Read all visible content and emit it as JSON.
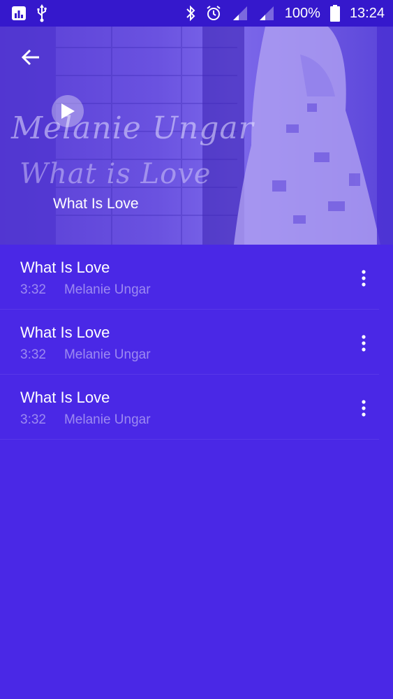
{
  "status_bar": {
    "battery": "100%",
    "time": "13:24",
    "icons": [
      "stats-icon",
      "usb-icon",
      "bluetooth-icon",
      "alarm-icon",
      "signal-icon",
      "signal-icon",
      "battery-icon"
    ]
  },
  "header": {
    "title": "What Is Love",
    "art_artist_text": "Melanie Ungar",
    "art_album_text": "What is Love",
    "back_icon": "arrow-left-icon",
    "play_icon": "play-icon"
  },
  "songs": [
    {
      "title": "What Is Love",
      "duration": "3:32",
      "artist": "Melanie Ungar"
    },
    {
      "title": "What Is Love",
      "duration": "3:32",
      "artist": "Melanie Ungar"
    },
    {
      "title": "What Is Love",
      "duration": "3:32",
      "artist": "Melanie Ungar"
    }
  ],
  "colors": {
    "background": "#4a28e6",
    "status_bar": "#3518cc",
    "text_primary": "#ffffff",
    "text_secondary": "#a99af0"
  }
}
